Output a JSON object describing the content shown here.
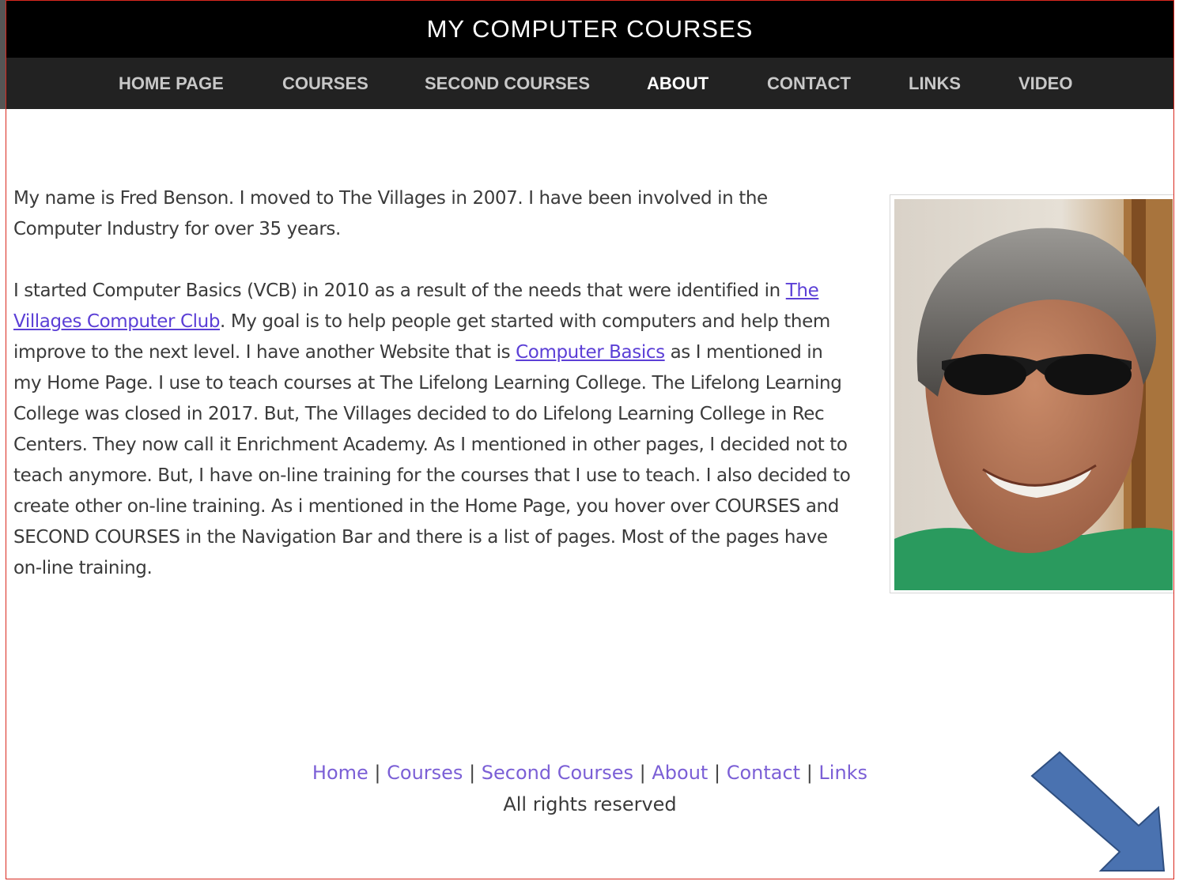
{
  "site": {
    "title": "MY COMPUTER COURSES"
  },
  "nav": {
    "items": [
      {
        "label": "HOME PAGE"
      },
      {
        "label": "COURSES"
      },
      {
        "label": "SECOND COURSES"
      },
      {
        "label": "ABOUT"
      },
      {
        "label": "CONTACT"
      },
      {
        "label": "LINKS"
      },
      {
        "label": "VIDEO"
      }
    ],
    "active": "ABOUT"
  },
  "about": {
    "p1": "My name is Fred Benson.  I moved to The Villages in 2007.  I have been involved in the Computer Industry for over 35 years.",
    "p2_before_link1": "I started Computer Basics (VCB) in 2010 as a result of the needs that were identified in ",
    "link1": "The Villages Computer Club",
    "p2_mid": ".  My goal is to help people get started with computers and help them improve to the next level.  I have another Website that is ",
    "link2": "Computer Basics",
    "p2_after": " as I mentioned in my Home Page.  I use to teach courses at The Lifelong Learning College.  The Lifelong Learning College was closed in 2017.  But, The Villages decided to do Lifelong Learning College in Rec Centers.  They now call it Enrichment Academy.  As I mentioned in other pages, I decided not to teach anymore.  But, I have on-line training for the courses that I use to teach.  I also decided to create other on-line training.  As i mentioned in the Home Page, you hover over COURSES and SECOND COURSES in the Navigation Bar and there is a list of pages.  Most of the pages have on-line training."
  },
  "footer": {
    "links": [
      {
        "label": "Home"
      },
      {
        "label": "Courses"
      },
      {
        "label": "Second Courses"
      },
      {
        "label": "About"
      },
      {
        "label": "Contact"
      },
      {
        "label": "Links"
      }
    ],
    "separator": "|",
    "rights": "All rights reserved"
  },
  "colors": {
    "title_bg": "#000000",
    "nav_bg": "#222222",
    "link": "#5b3fd6",
    "arrow": "#4a72b0"
  }
}
